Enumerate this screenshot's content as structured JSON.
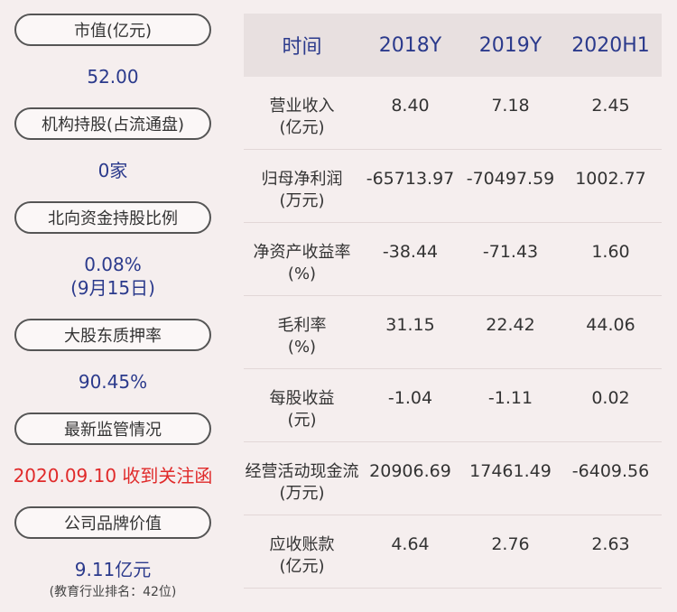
{
  "left": {
    "items": [
      {
        "label": "市值(亿元)",
        "value": "52.00"
      },
      {
        "label": "机构持股(占流通盘)",
        "value": "0家"
      },
      {
        "label": "北向资金持股比例",
        "value": "0.08%",
        "value2": "(9月15日)"
      },
      {
        "label": "大股东质押率",
        "value": "90.45%"
      },
      {
        "label": "最新监管情况",
        "value": "2020.09.10 收到关注函"
      },
      {
        "label": "公司品牌价值",
        "value": "9.11亿元",
        "note": "(教育行业排名：42位)"
      }
    ]
  },
  "table": {
    "headers": [
      "时间",
      "2018Y",
      "2019Y",
      "2020H1"
    ],
    "rows": [
      {
        "label1": "营业收入",
        "label2": "(亿元)",
        "values": [
          "8.40",
          "7.18",
          "2.45"
        ]
      },
      {
        "label1": "归母净利润",
        "label2": "(万元)",
        "values": [
          "-65713.97",
          "-70497.59",
          "1002.77"
        ]
      },
      {
        "label1": "净资产收益率",
        "label2": "(%)",
        "values": [
          "-38.44",
          "-71.43",
          "1.60"
        ]
      },
      {
        "label1": "毛利率",
        "label2": "(%)",
        "values": [
          "31.15",
          "22.42",
          "44.06"
        ]
      },
      {
        "label1": "每股收益",
        "label2": "(元)",
        "values": [
          "-1.04",
          "-1.11",
          "0.02"
        ]
      },
      {
        "label1": "经营活动现金流",
        "label2": "(万元)",
        "values": [
          "20906.69",
          "17461.49",
          "-6409.56"
        ]
      },
      {
        "label1": "应收账款",
        "label2": "(亿元)",
        "values": [
          "4.64",
          "2.76",
          "2.63"
        ]
      }
    ]
  },
  "colors": {
    "background": "#f5eeee",
    "value_blue": "#2b3a8c",
    "alert_red": "#e02a2a",
    "header_bg": "#e8e0e0"
  }
}
